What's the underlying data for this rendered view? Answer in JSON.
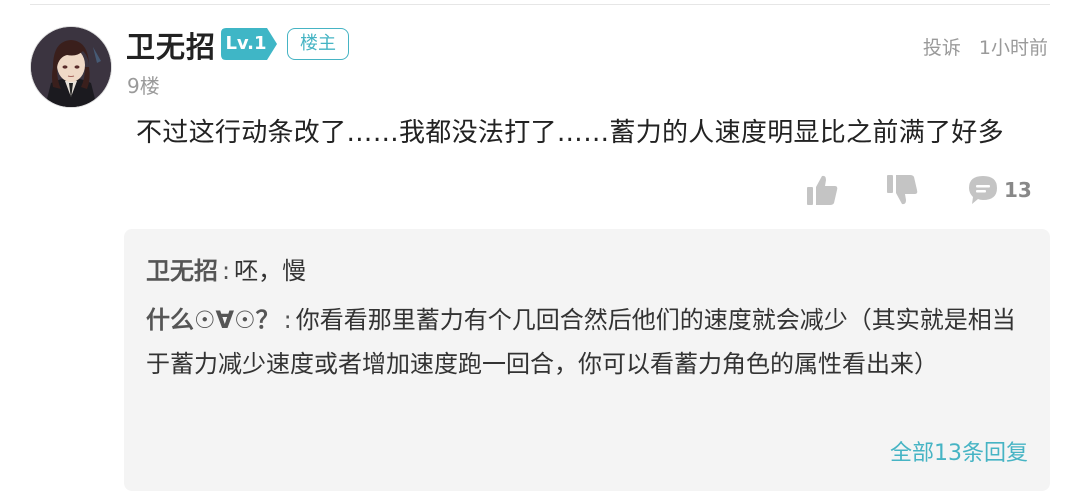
{
  "post": {
    "author": "卫无招",
    "level": "Lv.1",
    "owner_tag": "楼主",
    "floor": "9楼",
    "report": "投诉",
    "time": "1小时前",
    "content": "不过这行动条改了……我都没法打了……蓄力的人速度明显比之前满了好多"
  },
  "actions": {
    "like_icon": "thumbs-up-icon",
    "dislike_icon": "thumbs-down-icon",
    "comment_icon": "comment-bubble-icon",
    "comment_count": "13"
  },
  "replies": [
    {
      "author": "卫无招",
      "sep": ":",
      "text": "呸，慢"
    },
    {
      "author": "什么☉∀☉？",
      "sep": ":",
      "text": "你看看那里蓄力有个几回合然后他们的速度就会减少（其实就是相当于蓄力减少速度或者增加速度跑一回合，你可以看蓄力角色的属性看出来）"
    }
  ],
  "view_all_replies": "全部13条回复",
  "colors": {
    "accent": "#46b4c4",
    "badge": "#3fb6c6",
    "muted": "#9a9a9a",
    "reply_bg": "#f4f4f4"
  }
}
